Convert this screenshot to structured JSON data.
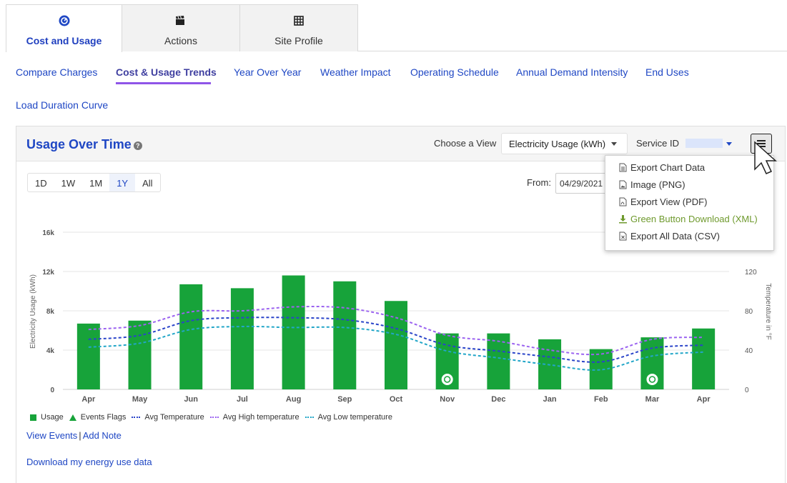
{
  "tabs": [
    {
      "label": "Cost and Usage",
      "icon": "gauge-icon",
      "active": true
    },
    {
      "label": "Actions",
      "icon": "clapperboard-icon",
      "active": false
    },
    {
      "label": "Site Profile",
      "icon": "grid-icon",
      "active": false
    }
  ],
  "subnav": [
    {
      "label": "Compare Charges",
      "active": false
    },
    {
      "label": "Cost & Usage Trends",
      "active": true
    },
    {
      "label": "Year Over Year",
      "active": false
    },
    {
      "label": "Weather Impact",
      "active": false
    },
    {
      "label": "Operating Schedule",
      "active": false
    },
    {
      "label": "Annual Demand Intensity",
      "active": false
    },
    {
      "label": "End Uses",
      "active": false
    },
    {
      "label": "Load Duration Curve",
      "active": false
    }
  ],
  "panel": {
    "title": "Usage Over Time",
    "help_icon": "help-icon",
    "view_label": "Choose a View",
    "view_value": "Electricity Usage (kWh)",
    "service_label": "Service ID",
    "menu_icon": "hamburger-icon"
  },
  "ranges": [
    "1D",
    "1W",
    "1M",
    "1Y",
    "All"
  ],
  "active_range": "1Y",
  "from_label": "From:",
  "from_value": "04/29/2021",
  "export_menu": [
    {
      "label": "Export Chart Data",
      "icon": "document-icon"
    },
    {
      "label": "Image (PNG)",
      "icon": "image-file-icon"
    },
    {
      "label": "Export View (PDF)",
      "icon": "pdf-file-icon"
    },
    {
      "label": "Green Button Download (XML)",
      "icon": "download-icon"
    },
    {
      "label": "Export All Data (CSV)",
      "icon": "csv-file-icon"
    }
  ],
  "chart_data": {
    "type": "bar",
    "categories": [
      "Apr",
      "May",
      "Jun",
      "Jul",
      "Aug",
      "Sep",
      "Oct",
      "Nov",
      "Dec",
      "Jan",
      "Feb",
      "Mar",
      "Apr"
    ],
    "ylabel": "Electricity Usage (kWh)",
    "y2label": "Temperature in °F",
    "ylim": [
      0,
      16000
    ],
    "y2lim": [
      0,
      160
    ],
    "yticks": [
      "0",
      "4k",
      "8k",
      "12k",
      "16k"
    ],
    "y2ticks": [
      "0",
      "40",
      "80",
      "120"
    ],
    "series": [
      {
        "name": "Usage",
        "type": "bar",
        "axis": "left",
        "color": "#17a33a",
        "values": [
          6700,
          7000,
          10700,
          10300,
          11600,
          11000,
          9000,
          5700,
          5700,
          5100,
          4100,
          5300,
          6200
        ]
      },
      {
        "name": "Avg Temperature",
        "type": "line",
        "axis": "right",
        "color": "#2a44c9",
        "values": [
          51,
          55,
          70,
          73,
          73,
          71,
          62,
          45,
          39,
          33,
          28,
          42,
          45
        ]
      },
      {
        "name": "Avg High temperature",
        "type": "line",
        "axis": "right",
        "color": "#9b63f0",
        "values": [
          61,
          65,
          79,
          80,
          84,
          83,
          73,
          55,
          49,
          40,
          36,
          51,
          53
        ]
      },
      {
        "name": "Avg Low temperature",
        "type": "line",
        "axis": "right",
        "color": "#22a6c8",
        "values": [
          43,
          47,
          61,
          64,
          63,
          63,
          56,
          39,
          32,
          25,
          20,
          34,
          38
        ]
      }
    ],
    "event_flags": [
      "Nov",
      "Mar"
    ],
    "legend_extra": "Events Flags",
    "legend_position": "bottom-left"
  },
  "links": {
    "view_events": "View Events",
    "add_note": "Add Note",
    "separator": "|"
  },
  "download_link": "Download my energy use data",
  "colors": {
    "accent": "#1f47c4",
    "tab_underline": "#8f55e8",
    "usage": "#17a33a",
    "green_button": "#6f9a2e"
  }
}
